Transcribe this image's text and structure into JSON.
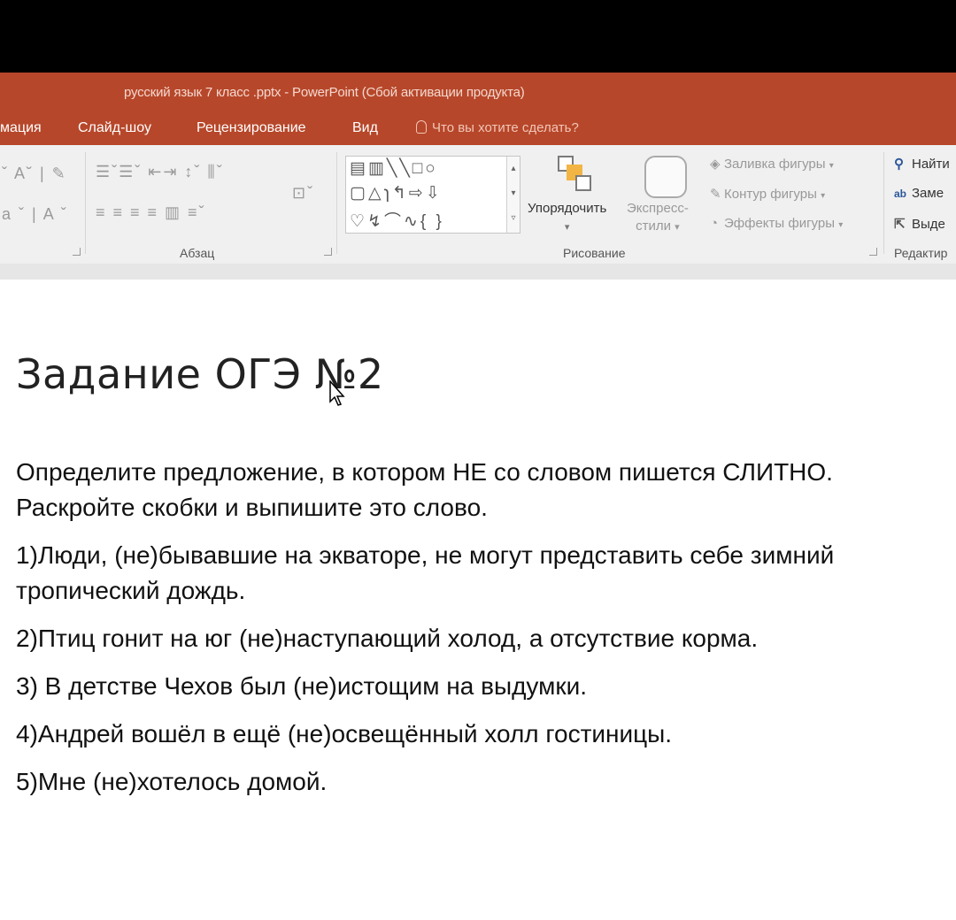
{
  "window": {
    "title": "русский язык 7 класс .pptx - PowerPoint (Сбой активации продукта)"
  },
  "tabs": [
    {
      "label": "мация"
    },
    {
      "label": "Слайд-шоу"
    },
    {
      "label": "Рецензирование"
    },
    {
      "label": "Вид"
    }
  ],
  "tell_me": {
    "placeholder": "Что вы хотите сделать?"
  },
  "ribbon": {
    "paragraph_group": "Абзац",
    "drawing_group": "Рисование",
    "editing_group": "Редактир",
    "arrange_label": "Упорядочить",
    "quick_styles_label_1": "Экспресс-",
    "quick_styles_label_2": "стили",
    "shape_fill": "Заливка фигуры",
    "shape_outline": "Контур фигуры",
    "shape_effects": "Эффекты фигуры",
    "find": "Найти",
    "replace": "Заме",
    "select": "Выде"
  },
  "slide": {
    "title": "Задание ОГЭ №2",
    "instruction": "Определите предложение, в котором НЕ со словом пишется СЛИТНО. Раскройте скобки и выпишите это слово.",
    "items": [
      "1)Люди, (не)бывавшие на экваторе, не могут представить себе зимний тропический дождь.",
      "2)Птиц гонит на юг (не)наступающий холод, а отсутствие корма.",
      "3) В детстве Чехов был (не)истощим на выдумки.",
      "4)Андрей вошёл в ещё (не)освещённый холл гостиницы.",
      "5)Мне (не)хотелось домой."
    ]
  },
  "colors": {
    "accent": "#b7472a",
    "ribbon_bg": "#f0f0f0"
  }
}
